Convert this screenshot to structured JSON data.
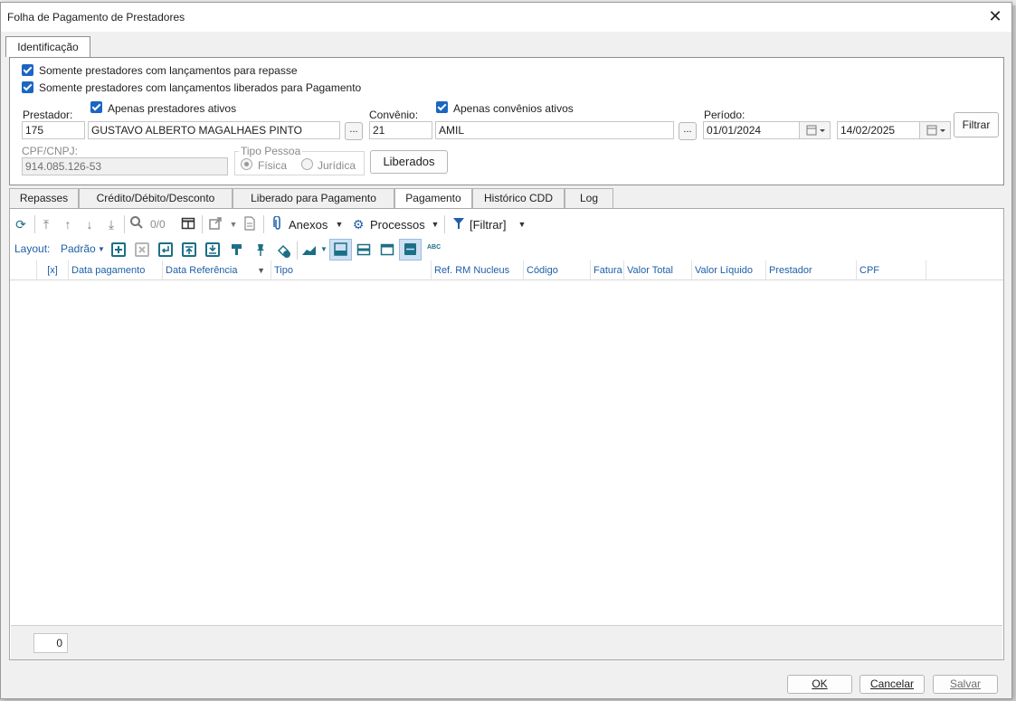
{
  "window": {
    "title": "Folha de Pagamento de Prestadores",
    "close_glyph": "✕"
  },
  "top_tab": "Identificação",
  "filters": {
    "check_repasse": "Somente prestadores com lançamentos para repasse",
    "check_liberados": "Somente prestadores com lançamentos liberados para Pagamento",
    "prestador_label": "Prestador:",
    "apenas_prestadores_ativos": "Apenas prestadores ativos",
    "prestador_code": "175",
    "prestador_name": "GUSTAVO ALBERTO MAGALHAES PINTO",
    "ellipsis": "...",
    "convenio_label": "Convênio:",
    "apenas_convenios_ativos": "Apenas convênios ativos",
    "convenio_code": "21",
    "convenio_name": "AMIL",
    "periodo_label": "Período:",
    "periodo_start": "01/01/2024",
    "periodo_end": "14/02/2025",
    "filtrar_button": "Filtrar",
    "cpf_label": "CPF/CNPJ:",
    "cpf_value": "914.085.126-53",
    "tipo_pessoa_label": "Tipo Pessoa",
    "fisica": "Física",
    "juridica": "Jurídica",
    "liberados_button": "Liberados"
  },
  "tabs": [
    {
      "label": "Repasses"
    },
    {
      "label": "Crédito/Débito/Desconto"
    },
    {
      "label": "Liberado para Pagamento"
    },
    {
      "label": "Pagamento"
    },
    {
      "label": "Histórico CDD"
    },
    {
      "label": "Log"
    }
  ],
  "toolbar": {
    "counter": "0/0",
    "anexos": "Anexos",
    "processos": "Processos",
    "filtrar": "[Filtrar]",
    "layout_label": "Layout:",
    "layout_value": "Padrão",
    "abc": "ABC"
  },
  "grid": {
    "columns": [
      "[x]",
      "Data pagamento",
      "Data Referência",
      "Tipo",
      "Ref. RM Nucleus",
      "Código",
      "Fatura",
      "Valor Total",
      "Valor Líquido",
      "Prestador",
      "CPF"
    ],
    "row_count": "0"
  },
  "dialog_buttons": {
    "ok": "OK",
    "cancel": "Cancelar",
    "save": "Salvar"
  }
}
